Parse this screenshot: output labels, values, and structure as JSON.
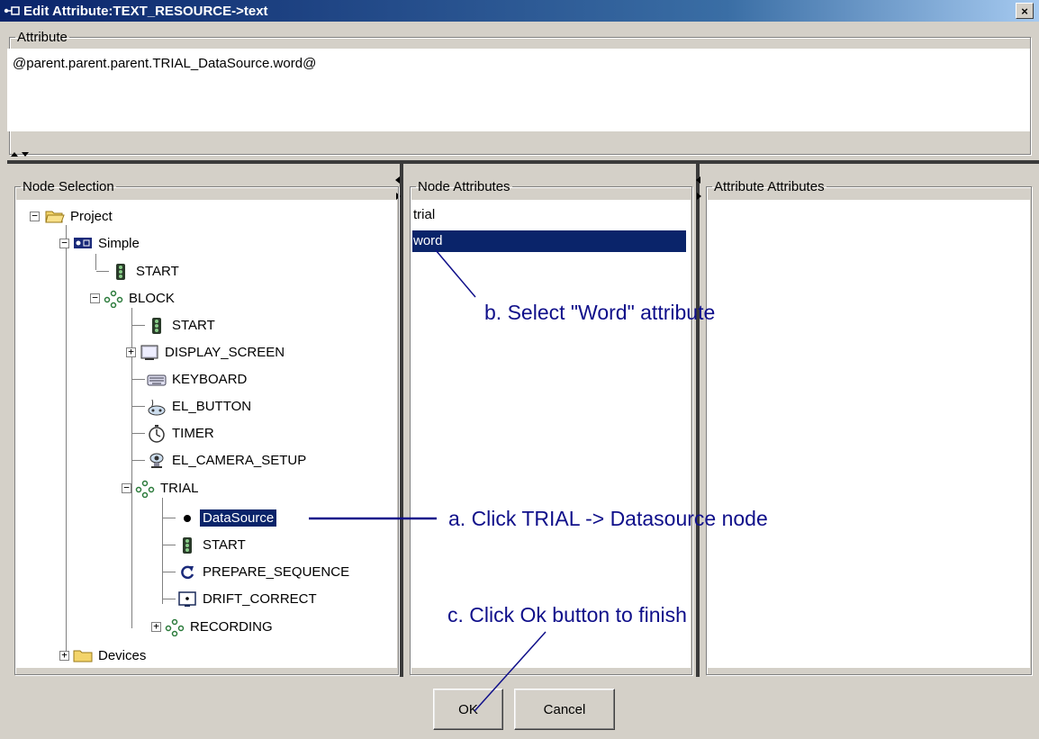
{
  "window": {
    "title": "Edit Attribute:TEXT_RESOURCE->text",
    "close_label": "×",
    "app_icon": "node-link-icon"
  },
  "attribute_group": {
    "legend": "Attribute",
    "value": "@parent.parent.parent.TRIAL_DataSource.word@"
  },
  "node_selection": {
    "legend": "Node Selection",
    "tree": [
      {
        "label": "Project",
        "icon": "folder-open-icon",
        "expanded": true
      },
      {
        "label": "Simple",
        "icon": "experiment-icon",
        "expanded": true
      },
      {
        "label": "START",
        "icon": "traffic-light-icon"
      },
      {
        "label": "BLOCK",
        "icon": "sequence-icon",
        "expanded": true
      },
      {
        "label": "START",
        "icon": "traffic-light-icon"
      },
      {
        "label": "DISPLAY_SCREEN",
        "icon": "monitor-icon",
        "expanded": false
      },
      {
        "label": "KEYBOARD",
        "icon": "keyboard-icon"
      },
      {
        "label": "EL_BUTTON",
        "icon": "gamepad-icon"
      },
      {
        "label": "TIMER",
        "icon": "timer-icon"
      },
      {
        "label": "EL_CAMERA_SETUP",
        "icon": "eye-camera-icon"
      },
      {
        "label": "TRIAL",
        "icon": "sequence-icon",
        "expanded": true
      },
      {
        "label": "DataSource",
        "icon": "datasource-dot-icon",
        "selected": true
      },
      {
        "label": "START",
        "icon": "traffic-light-icon"
      },
      {
        "label": "PREPARE_SEQUENCE",
        "icon": "refresh-icon"
      },
      {
        "label": "DRIFT_CORRECT",
        "icon": "drift-correct-icon"
      },
      {
        "label": "RECORDING",
        "icon": "sequence-icon",
        "expanded": false
      },
      {
        "label": "Devices",
        "icon": "folder-icon",
        "expanded": false
      }
    ]
  },
  "node_attributes": {
    "legend": "Node Attributes",
    "items": [
      {
        "label": "trial",
        "selected": false
      },
      {
        "label": "word",
        "selected": true
      }
    ]
  },
  "attribute_attributes": {
    "legend": "Attribute Attributes"
  },
  "annotations": {
    "a": "a. Click TRIAL -> Datasource node",
    "b": "b. Select \"Word\" attribute",
    "c": "c. Click Ok button to finish"
  },
  "buttons": {
    "ok": "OK",
    "cancel": "Cancel"
  },
  "colors": {
    "selection": "#0a246a",
    "annotation": "#0f0f8a",
    "titlebar_start": "#0a246a",
    "titlebar_end": "#a6caf0",
    "dialog_bg": "#d4d0c8"
  }
}
